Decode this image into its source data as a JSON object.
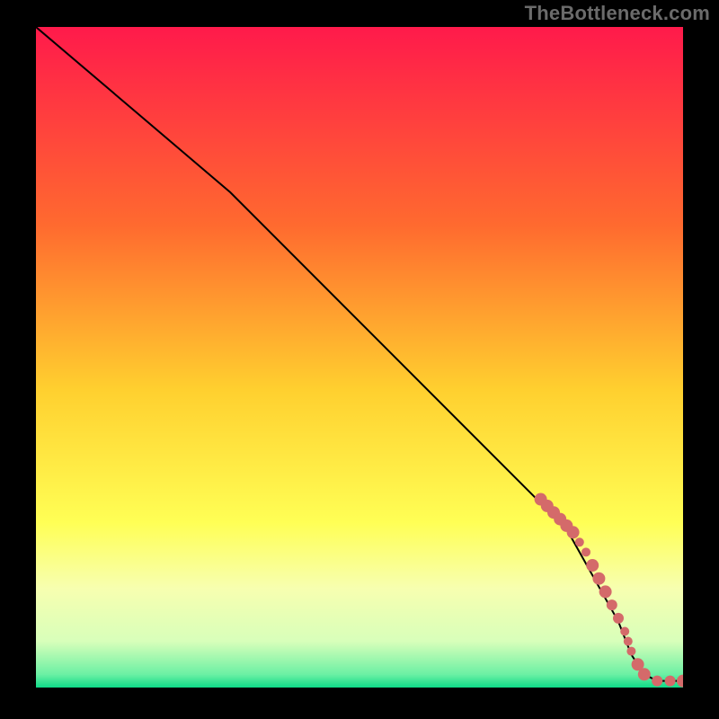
{
  "attribution": "TheBottleneck.com",
  "chart_data": {
    "type": "line",
    "title": "",
    "xlabel": "",
    "ylabel": "",
    "xlim": [
      0,
      100
    ],
    "ylim": [
      0,
      100
    ],
    "gradient_stops": [
      {
        "offset": 0,
        "color": "#ff1a4b"
      },
      {
        "offset": 0.3,
        "color": "#ff6a2f"
      },
      {
        "offset": 0.55,
        "color": "#ffd02f"
      },
      {
        "offset": 0.75,
        "color": "#ffff55"
      },
      {
        "offset": 0.85,
        "color": "#f7ffb0"
      },
      {
        "offset": 0.93,
        "color": "#d8ffba"
      },
      {
        "offset": 0.98,
        "color": "#6cf0a4"
      },
      {
        "offset": 1.0,
        "color": "#0edb88"
      }
    ],
    "series": [
      {
        "name": "curve",
        "points": [
          {
            "x": 0,
            "y": 100
          },
          {
            "x": 30,
            "y": 75
          },
          {
            "x": 82,
            "y": 24
          },
          {
            "x": 90,
            "y": 10
          },
          {
            "x": 92,
            "y": 5
          },
          {
            "x": 94,
            "y": 2
          },
          {
            "x": 96,
            "y": 1
          },
          {
            "x": 100,
            "y": 1
          }
        ]
      }
    ],
    "markers": [
      {
        "x": 78,
        "y": 28.5,
        "r": 7
      },
      {
        "x": 79,
        "y": 27.5,
        "r": 7
      },
      {
        "x": 80,
        "y": 26.5,
        "r": 7
      },
      {
        "x": 81,
        "y": 25.5,
        "r": 7
      },
      {
        "x": 82,
        "y": 24.5,
        "r": 7
      },
      {
        "x": 83,
        "y": 23.5,
        "r": 7
      },
      {
        "x": 84,
        "y": 22,
        "r": 5
      },
      {
        "x": 85,
        "y": 20.5,
        "r": 5
      },
      {
        "x": 86,
        "y": 18.5,
        "r": 7
      },
      {
        "x": 87,
        "y": 16.5,
        "r": 7
      },
      {
        "x": 88,
        "y": 14.5,
        "r": 7
      },
      {
        "x": 89,
        "y": 12.5,
        "r": 6
      },
      {
        "x": 90,
        "y": 10.5,
        "r": 6
      },
      {
        "x": 91,
        "y": 8.5,
        "r": 5
      },
      {
        "x": 91.5,
        "y": 7,
        "r": 5
      },
      {
        "x": 92,
        "y": 5.5,
        "r": 5
      },
      {
        "x": 93,
        "y": 3.5,
        "r": 7
      },
      {
        "x": 94,
        "y": 2,
        "r": 7
      },
      {
        "x": 96,
        "y": 1,
        "r": 6
      },
      {
        "x": 98,
        "y": 1,
        "r": 6
      },
      {
        "x": 100,
        "y": 1,
        "r": 7
      }
    ],
    "marker_color": "#d46a6a",
    "line_color": "#000000"
  }
}
